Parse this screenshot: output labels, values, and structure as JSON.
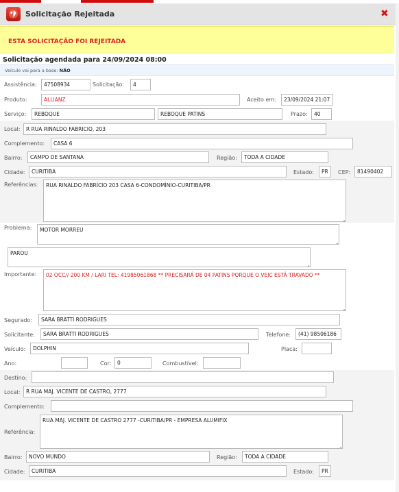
{
  "window": {
    "title": "Solicitação Rejeitada",
    "close_icon": "close-icon",
    "app_icon": "globe-icon"
  },
  "alert": {
    "text": "ESTA SOLICITAÇÃO FOI REJEITADA",
    "color": "#e02020",
    "background": "#ffff99"
  },
  "schedule": {
    "text": "Solicitação agendada para 24/09/2024 08:00"
  },
  "base": {
    "label": "Veículo vai para a base:",
    "value": "NÃO"
  },
  "fields": {
    "assistencia": {
      "label": "Assistência:",
      "value": "47508934"
    },
    "solicitacao": {
      "label": "Solicitação:",
      "value": "4"
    },
    "produto": {
      "label": "Produto:",
      "value": "ALLIANZ"
    },
    "aceito_em": {
      "label": "Aceito em:",
      "value": "23/09/2024 21:07"
    },
    "servico": {
      "label": "Serviço:",
      "value": "REBOQUE",
      "value2": "REBOQUE PATINS"
    },
    "prazo": {
      "label": "Prazo:",
      "value": "40"
    },
    "local": {
      "label": "Local:",
      "value": "R RUA RINALDO FABRICIO, 203"
    },
    "complemento": {
      "label": "Complemento:",
      "value": "CASA 6"
    },
    "bairro": {
      "label": "Bairro:",
      "value": "CAMPO DE SANTANA"
    },
    "regiao": {
      "label": "Região:",
      "value": "TODA A CIDADE"
    },
    "cidade": {
      "label": "Cidade:",
      "value": "CURITIBA"
    },
    "estado": {
      "label": "Estado:",
      "value": "PR"
    },
    "cep": {
      "label": "CEP:",
      "value": "81490402"
    },
    "referencias": {
      "label": "Referências:",
      "value": "RUA RINALDO FABRÍCIO 203 CASA 6-CONDOMÍNIO-CURITIBA/PR"
    },
    "problema": {
      "label": "Problema:",
      "value": "MOTOR MORREU",
      "value2": "PAROU"
    },
    "importante": {
      "label": "Importante:",
      "value": "02 OCC// 200 KM / LARI TEL: 41985061868  **   PRECISARÁ DE 04 PATINS PORQUE O VEIC ESTÁ  TRAVADO **"
    },
    "segurado": {
      "label": "Segurado:",
      "value": "SARA BRATTI RODRIGUES"
    },
    "solicitante": {
      "label": "Solicitante:",
      "value": "SARA BRATTI RODRIGUES"
    },
    "telefone": {
      "label": "Telefone:",
      "value": "(41) 98506186"
    },
    "veiculo": {
      "label": "Veículo:",
      "value": "DOLPHIN"
    },
    "placa": {
      "label": "Placa:",
      "value": ""
    },
    "ano": {
      "label": "Ano:",
      "value": ""
    },
    "cor": {
      "label": "Cor:",
      "value": "0"
    },
    "combustivel": {
      "label": "Combustível:",
      "value": ""
    }
  },
  "destino": {
    "destino": {
      "label": "Destino:",
      "value": ""
    },
    "local": {
      "label": "Local:",
      "value": "R RUA MAJ. VICENTE DE CASTRO, 2777"
    },
    "complemento": {
      "label": "Complemento:",
      "value": ""
    },
    "referencia": {
      "label": "Referência:",
      "value": "RUA MAJ. VICENTE DE CASTRO 2777  -CURITIBA/PR - EMPRESA ALUMIFIX"
    },
    "bairro": {
      "label": "Bairro:",
      "value": "NOVO MUNDO"
    },
    "regiao": {
      "label": "Região:",
      "value": "TODA A CIDADE"
    },
    "cidade": {
      "label": "Cidade:",
      "value": "CURITIBA"
    },
    "estado": {
      "label": "Estado:",
      "value": "PR"
    }
  }
}
